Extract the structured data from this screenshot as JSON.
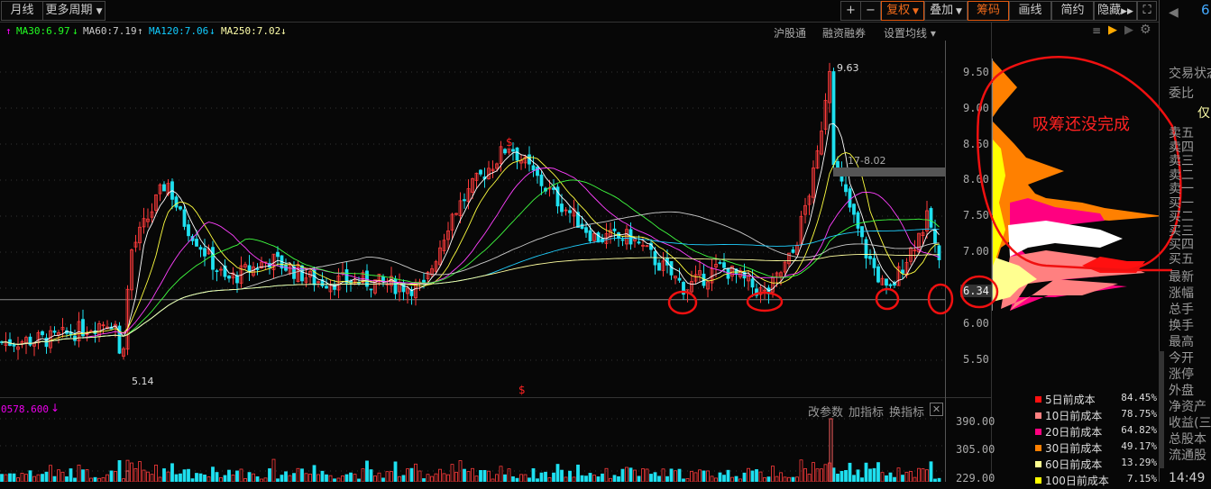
{
  "toolbar": {
    "monthly": "月线",
    "more_periods": "更多周期",
    "plus": "+",
    "minus": "−",
    "fuquan": "复权",
    "overlay": "叠加",
    "chips": "筹码",
    "draw": "画线",
    "simple": "简约",
    "hide": "隐藏",
    "fullscreen_icon": "expand-icon"
  },
  "ma": {
    "ma30": "MA30:6.97",
    "ma60": "MA60:7.19",
    "ma120": "MA120:7.06",
    "ma250": "MA250:7.02"
  },
  "links": {
    "hgt": "沪股通",
    "margin": "融资融券",
    "set_ma": "设置均线"
  },
  "price_axis": [
    "9.50",
    "9.00",
    "8.50",
    "8.00",
    "7.50",
    "7.00",
    "6.00",
    "5.50"
  ],
  "current_price": "6.34",
  "labels": {
    "high": "9.63",
    "low": "5.14",
    "marker": "17-8.02",
    "dollar": "$"
  },
  "annotation": "吸筹还没完成",
  "volume": {
    "value": "0578.600",
    "axis": [
      "390.00",
      "305.00",
      "229.00"
    ],
    "edit": "改参数",
    "add": "加指标",
    "switch": "换指标"
  },
  "legend": [
    {
      "label": "5日前成本",
      "pct": "84.45%",
      "color": "#ff1010"
    },
    {
      "label": "10日前成本",
      "pct": "78.75%",
      "color": "#ff8080"
    },
    {
      "label": "20日前成本",
      "pct": "64.82%",
      "color": "#ff0080"
    },
    {
      "label": "30日前成本",
      "pct": "49.17%",
      "color": "#ff8000"
    },
    {
      "label": "60日前成本",
      "pct": "13.29%",
      "color": "#ffff90"
    },
    {
      "label": "100日前成本",
      "pct": "7.15%",
      "color": "#ffff00"
    }
  ],
  "quote": {
    "top": "6",
    "status": "交易状态",
    "ratio": "委比",
    "only": "仅",
    "sell": [
      "卖五",
      "卖四",
      "卖三",
      "卖二",
      "卖一"
    ],
    "buy": [
      "买一",
      "买二",
      "买三",
      "买四",
      "买五"
    ],
    "fields": [
      "最新",
      "涨幅",
      "总手",
      "换手",
      "最高",
      "今开",
      "涨停",
      "外盘",
      "净资产",
      "收益(三)",
      "总股本",
      "流通股"
    ],
    "time": "14:49"
  },
  "price_path": [
    [
      0,
      5.75
    ],
    [
      60,
      5.8
    ],
    [
      120,
      6.05
    ],
    [
      130,
      6.0
    ],
    [
      134,
      5.3
    ],
    [
      145,
      7.0
    ],
    [
      185,
      8.0
    ],
    [
      200,
      7.5
    ],
    [
      250,
      6.6
    ],
    [
      300,
      6.9
    ],
    [
      350,
      6.6
    ],
    [
      400,
      6.6
    ],
    [
      470,
      6.5
    ],
    [
      500,
      7.5
    ],
    [
      530,
      8.0
    ],
    [
      565,
      8.5
    ],
    [
      590,
      8.1
    ],
    [
      620,
      7.7
    ],
    [
      660,
      7.2
    ],
    [
      700,
      7.2
    ],
    [
      760,
      6.5
    ],
    [
      800,
      6.8
    ],
    [
      850,
      6.4
    ],
    [
      880,
      7.0
    ],
    [
      905,
      8.2
    ],
    [
      920,
      9.6
    ],
    [
      925,
      8.2
    ],
    [
      940,
      7.7
    ],
    [
      960,
      7.0
    ],
    [
      985,
      6.4
    ],
    [
      1000,
      6.8
    ],
    [
      1030,
      7.5
    ],
    [
      1045,
      6.6
    ]
  ]
}
